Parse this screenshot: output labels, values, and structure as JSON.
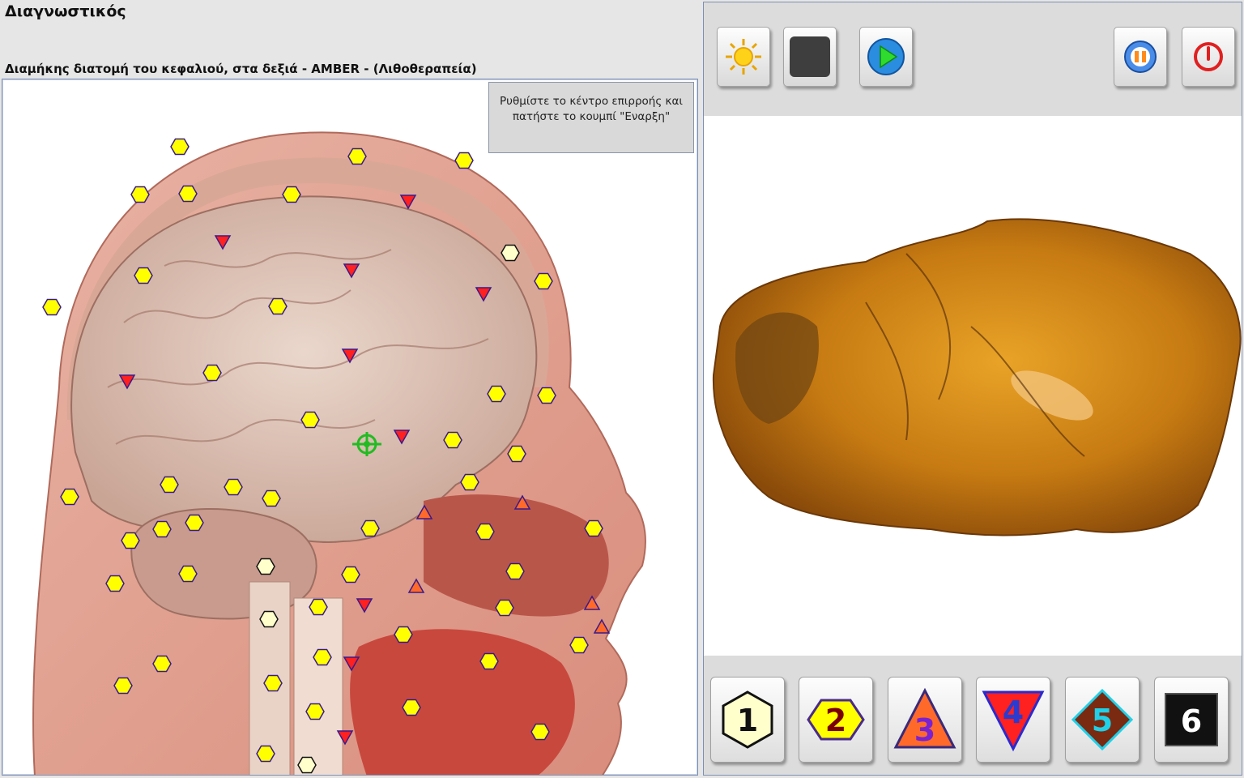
{
  "app_title": "Διαγνωστικός",
  "view_title": "Διαμήκης διατομή του κεφαλιού, στα δεξιά - AMBER - (Λιθοθεραπεία)",
  "hint_text": "Ρυθμίστε το κέντρο επιρροής και πατήστε το κουμπί \"Εναρξη\"",
  "toolbar": {
    "buttons": [
      {
        "name": "day-mode-button",
        "icon": "sun-icon"
      },
      {
        "name": "night-mode-button",
        "icon": "moon-icon"
      },
      {
        "name": "start-button",
        "icon": "play-icon"
      },
      {
        "name": "pause-button",
        "icon": "pause-icon"
      },
      {
        "name": "power-button",
        "icon": "power-icon"
      }
    ]
  },
  "marker_legend": [
    {
      "label": "1",
      "shape": "hexagon",
      "fill": "#ffffcc",
      "text_color": "#111111"
    },
    {
      "label": "2",
      "shape": "hexagon",
      "fill": "#ffff00",
      "text_color": "#7a0000"
    },
    {
      "label": "3",
      "shape": "triangle-up",
      "fill": "#ff6a2a",
      "text_color": "#7a22d0"
    },
    {
      "label": "4",
      "shape": "triangle-down",
      "fill": "#ff2020",
      "text_color": "#2a3bd0"
    },
    {
      "label": "5",
      "shape": "diamond",
      "fill": "#7a2a10",
      "text_color": "#20d0e8"
    },
    {
      "label": "6",
      "shape": "square",
      "fill": "#111111",
      "text_color": "#ffffff"
    }
  ],
  "colors": {
    "marker_outline": "#3a1a8a",
    "target_marker": "#22bb22",
    "amber": "#c07a10"
  }
}
